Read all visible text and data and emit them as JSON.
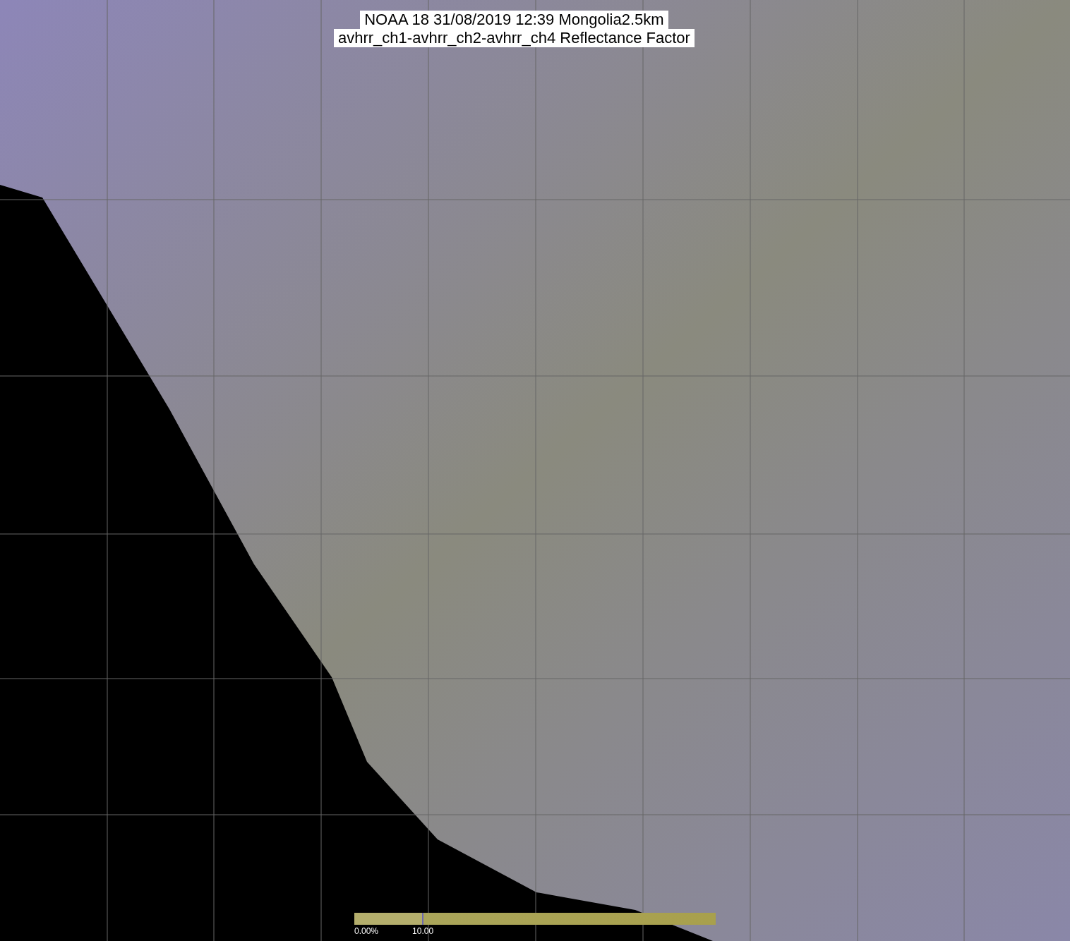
{
  "title": {
    "lines": [
      "NOAA 18 31/08/2019 12:39 Mongolia2.5km",
      "avhrr_ch1-avhrr_ch2-avhrr_ch4 Reflectance Factor"
    ]
  },
  "colorbar": {
    "labels": [
      "0.00%",
      "10.00"
    ]
  }
}
